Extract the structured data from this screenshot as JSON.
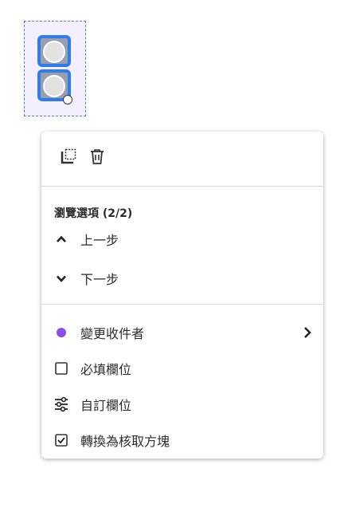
{
  "field": {
    "type": "radio-group",
    "items_count": 2,
    "colors": {
      "selection_border": "#2f7bf1",
      "field_background": "#f3efff"
    }
  },
  "toolbar": {
    "icons": [
      "select-area-icon",
      "trash-icon"
    ]
  },
  "browse_section": {
    "title": "瀏覽選項 (2/2)",
    "items": [
      {
        "icon": "chevron-up-icon",
        "label": "上一步"
      },
      {
        "icon": "chevron-down-icon",
        "label": "下一步"
      }
    ]
  },
  "actions": [
    {
      "icon": "purple-dot-icon",
      "label": "變更收件者",
      "has_submenu": true,
      "color": "#8a4df0"
    },
    {
      "icon": "checkbox-empty-icon",
      "label": "必填欄位"
    },
    {
      "icon": "sliders-icon",
      "label": "自訂欄位"
    },
    {
      "icon": "checkbox-checked-icon",
      "label": "轉換為核取方塊"
    }
  ]
}
